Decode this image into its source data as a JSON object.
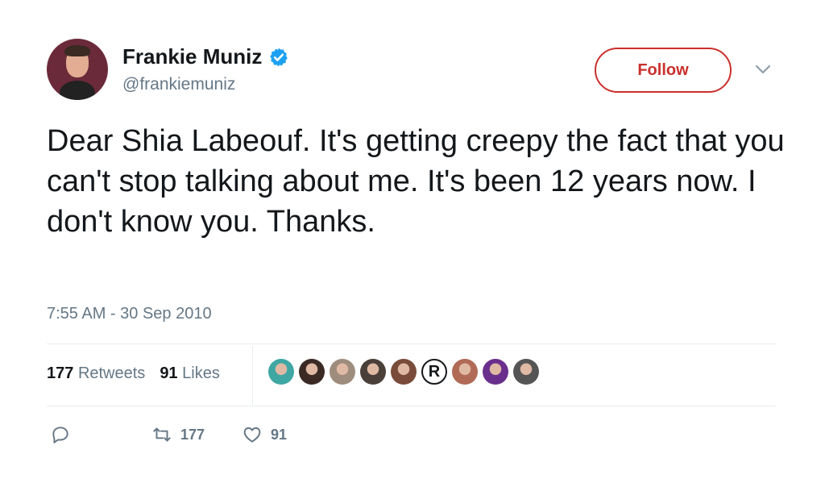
{
  "user": {
    "name": "Frankie Muniz",
    "handle": "@frankiemuniz",
    "verified": true
  },
  "follow_button": {
    "label": "Follow",
    "color": "#c9302c"
  },
  "tweet": {
    "text": "Dear Shia Labeouf. It's getting creepy the fact that you can't stop talking about me. It's been 12 years now. I don't know you. Thanks.",
    "timestamp": "7:55 AM - 30 Sep 2010"
  },
  "stats": {
    "retweets_count": "177",
    "retweets_label": "Retweets",
    "likes_count": "91",
    "likes_label": "Likes"
  },
  "likers": [
    {
      "name": "liker-avatar-1",
      "color": "#3fa7a3"
    },
    {
      "name": "liker-avatar-2",
      "color": "#3b2a24"
    },
    {
      "name": "liker-avatar-3",
      "color": "#9e8c7d"
    },
    {
      "name": "liker-avatar-4",
      "color": "#4a3f39"
    },
    {
      "name": "liker-avatar-5",
      "color": "#7a4b3a"
    },
    {
      "name": "liker-avatar-6",
      "color": "#ffffff",
      "glyph": "R"
    },
    {
      "name": "liker-avatar-7",
      "color": "#b06a55"
    },
    {
      "name": "liker-avatar-8",
      "color": "#6a2f8c"
    },
    {
      "name": "liker-avatar-9",
      "color": "#555555"
    }
  ],
  "actions": {
    "reply_icon": "reply-icon",
    "retweet_icon": "retweet-icon",
    "retweet_count": "177",
    "like_icon": "heart-icon",
    "like_count": "91"
  },
  "colors": {
    "text": "#14171a",
    "secondary": "#657786",
    "verified": "#1da1f2",
    "divider": "#e6ecf0"
  }
}
